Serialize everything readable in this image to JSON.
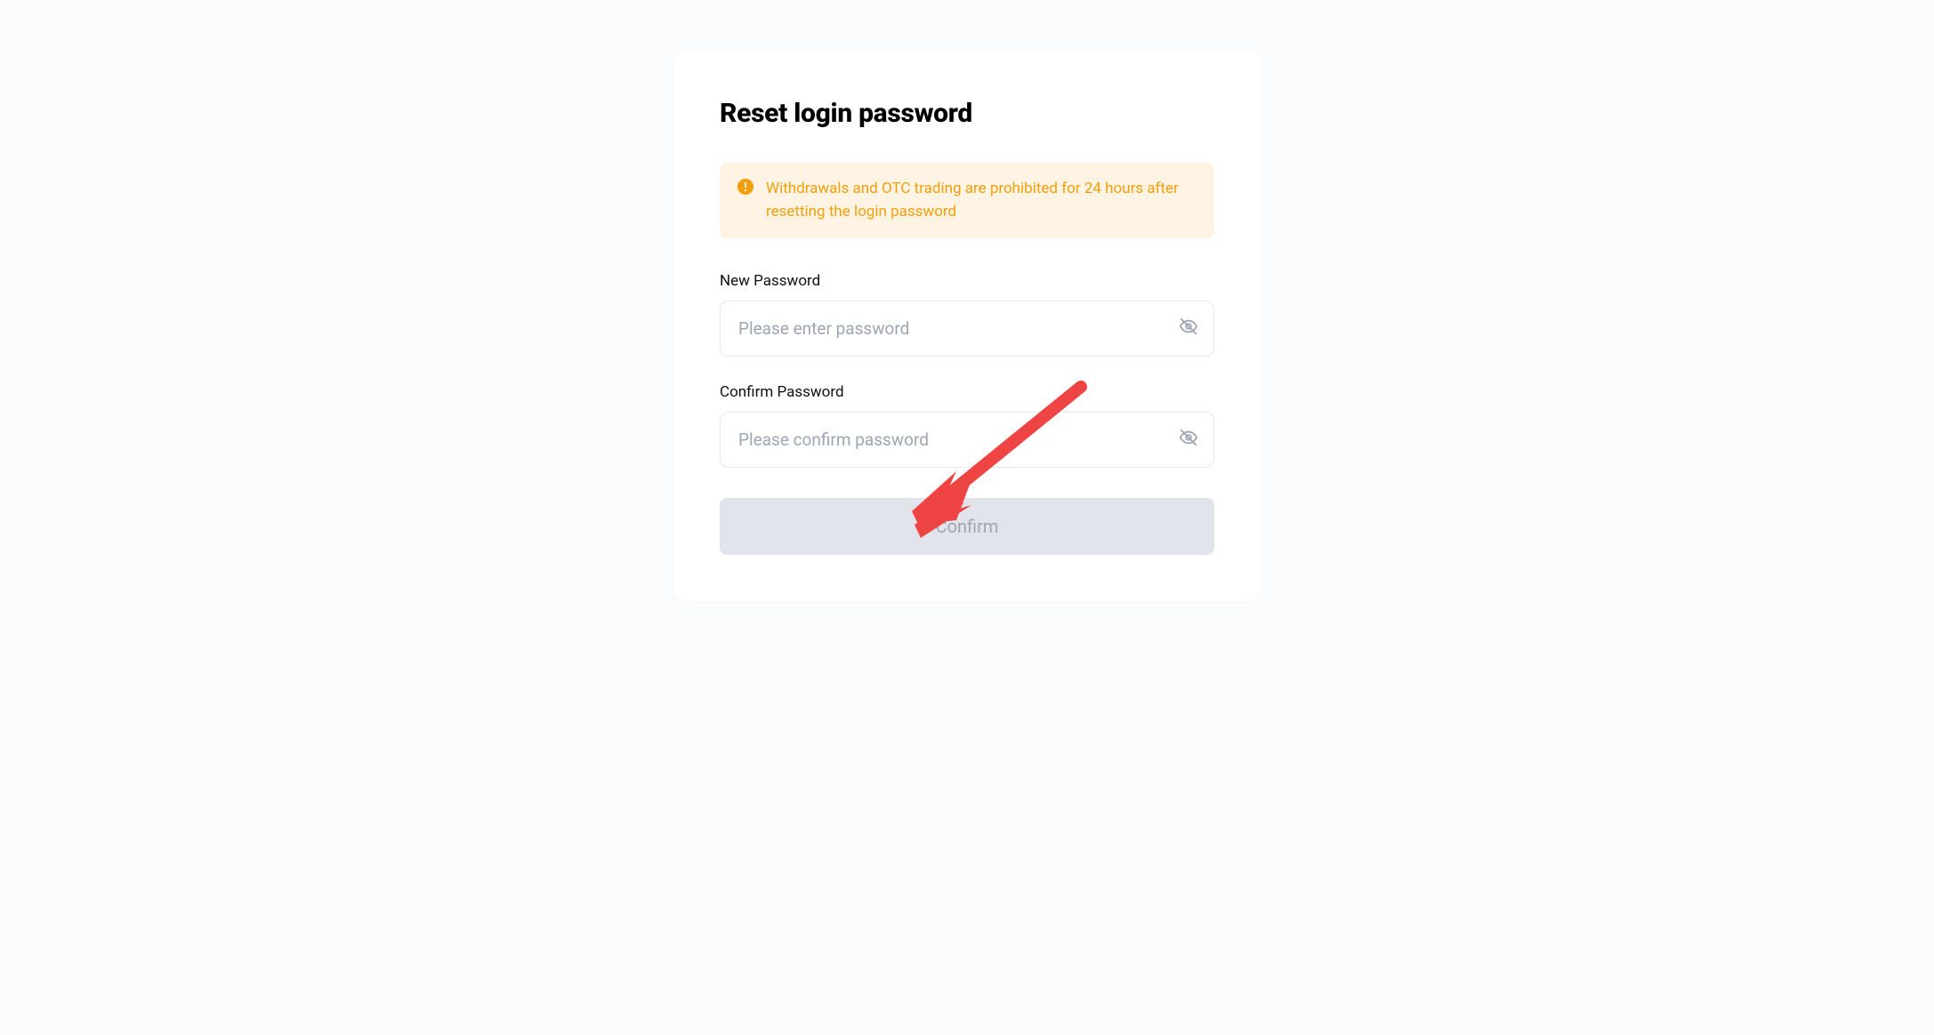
{
  "title": "Reset login password",
  "warning": {
    "message": "Withdrawals and OTC trading are prohibited for 24 hours after resetting the login password"
  },
  "fields": {
    "newPassword": {
      "label": "New Password",
      "placeholder": "Please enter password",
      "value": ""
    },
    "confirmPassword": {
      "label": "Confirm Password",
      "placeholder": "Please confirm password",
      "value": ""
    }
  },
  "confirmButton": {
    "label": "Confirm"
  },
  "colors": {
    "warningBg": "#fff4e3",
    "warningText": "#f59e0b",
    "buttonBg": "#e1e4ea",
    "buttonText": "#9ea5b3",
    "borderColor": "#e5e7eb",
    "placeholderColor": "#9ea5b3",
    "arrowColor": "#ef4444"
  }
}
